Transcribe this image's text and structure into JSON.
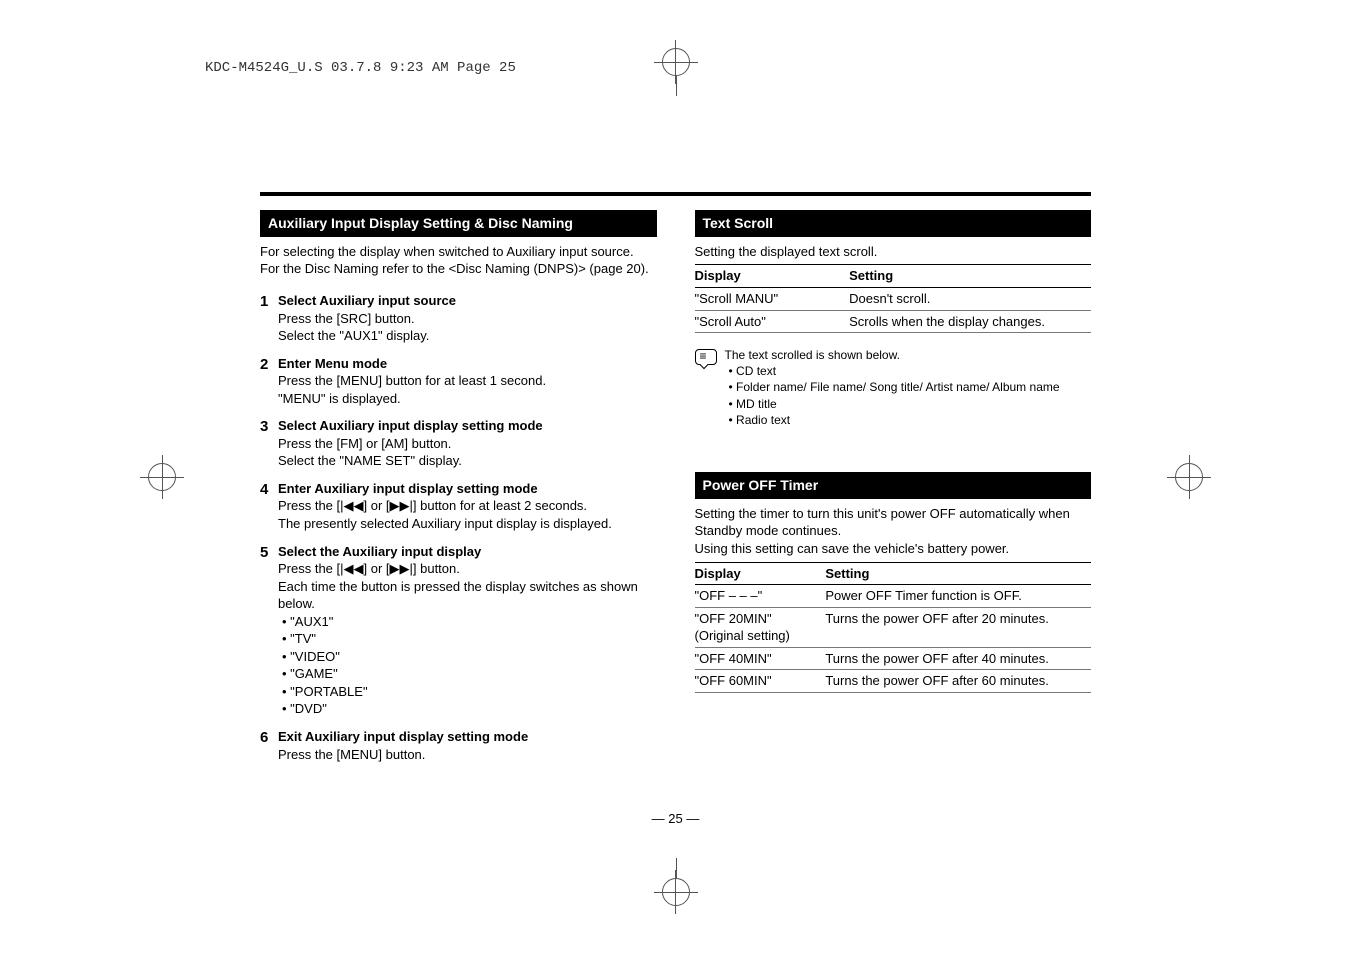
{
  "header": "KDC-M4524G_U.S  03.7.8  9:23 AM  Page 25",
  "left": {
    "sectionTitle": "Auxiliary Input Display Setting & Disc Naming",
    "intro": "For selecting the display when switched to Auxiliary input source. For the Disc Naming refer to the <Disc Naming (DNPS)> (page 20).",
    "steps": [
      {
        "num": "1",
        "title": "Select Auxiliary input source",
        "lines": [
          "Press the [SRC] button.",
          "Select the \"AUX1\" display."
        ]
      },
      {
        "num": "2",
        "title": "Enter Menu mode",
        "lines": [
          "Press the [MENU] button for at least 1 second.",
          "\"MENU\" is displayed."
        ]
      },
      {
        "num": "3",
        "title": "Select Auxiliary input display setting mode",
        "lines": [
          "Press the [FM] or [AM] button.",
          "Select the \"NAME SET\" display."
        ]
      },
      {
        "num": "4",
        "title": "Enter Auxiliary input display setting mode",
        "lines": [
          "Press the [|◀◀] or [▶▶|] button for at least 2 seconds.",
          "The presently selected Auxiliary input display is displayed."
        ]
      },
      {
        "num": "5",
        "title": "Select the Auxiliary input display",
        "lines": [
          "Press the [|◀◀] or [▶▶|] button.",
          "Each time the button is pressed the display switches as shown below."
        ],
        "bullets": [
          "\"AUX1\"",
          "\"TV\"",
          "\"VIDEO\"",
          "\"GAME\"",
          "\"PORTABLE\"",
          "\"DVD\""
        ]
      },
      {
        "num": "6",
        "title": "Exit Auxiliary input display setting mode",
        "lines": [
          "Press the [MENU] button."
        ]
      }
    ]
  },
  "right": {
    "textScroll": {
      "title": "Text Scroll",
      "intro": "Setting the displayed text scroll.",
      "table": {
        "head": [
          "Display",
          "Setting"
        ],
        "rows": [
          [
            "\"Scroll MANU\"",
            "Doesn't scroll."
          ],
          [
            "\"Scroll Auto\"",
            "Scrolls when the display changes."
          ]
        ]
      },
      "noteIntro": "The text scrolled is shown below.",
      "noteBullets": [
        "CD text",
        "Folder name/ File name/ Song title/ Artist name/ Album name",
        "MD title",
        "Radio text"
      ]
    },
    "powerOff": {
      "title": "Power OFF Timer",
      "intro": "Setting the timer to turn this unit's power OFF automatically when Standby mode continues.\nUsing this setting can save the vehicle's battery power.",
      "table": {
        "head": [
          "Display",
          "Setting"
        ],
        "rows": [
          [
            "\"OFF – – –\"",
            "Power OFF Timer function is OFF."
          ],
          [
            "\"OFF 20MIN\"\n(Original setting)",
            "Turns the power OFF after 20 minutes."
          ],
          [
            "\"OFF 40MIN\"",
            "Turns the power OFF after 40 minutes."
          ],
          [
            "\"OFF 60MIN\"",
            "Turns the power OFF after 60 minutes."
          ]
        ]
      }
    }
  },
  "pageNumber": "— 25 —"
}
